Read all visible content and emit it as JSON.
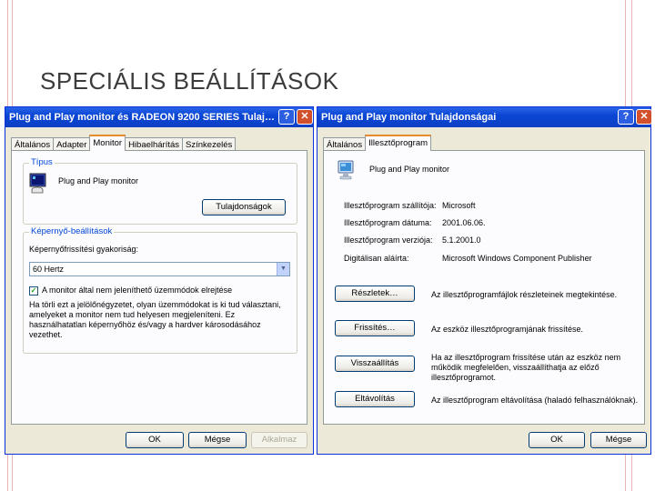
{
  "slide": {
    "title": "SPECIÁLIS BEÁLLÍTÁSOK"
  },
  "left_dialog": {
    "title": "Plug and Play monitor és RADEON 9200 SERIES  Tulaj…",
    "help_glyph": "?",
    "close_glyph": "✕",
    "tabs": [
      "Általános",
      "Adapter",
      "Monitor",
      "Hibaelhárítás",
      "Színkezelés"
    ],
    "active_tab": "Monitor",
    "type_group": {
      "title": "Típus",
      "monitor_name": "Plug and Play monitor",
      "properties_button": "Tulajdonságok"
    },
    "settings_group": {
      "title": "Képernyő-beállítások",
      "refresh_label": "Képernyőfrissítési gyakoriság:",
      "refresh_value": "60 Hertz",
      "hide_modes_label": "A monitor által nem jeleníthető üzemmódok elrejtése",
      "hide_modes_checked": true,
      "explanation": "Ha törli ezt a jelölőnégyzetet, olyan üzemmódokat is ki tud választani, amelyeket a monitor nem tud helyesen megjeleníteni. Ez használhatatlan képernyőhöz és/vagy a hardver károsodásához vezethet."
    },
    "buttons": {
      "ok": "OK",
      "cancel": "Mégse",
      "apply": "Alkalmaz"
    }
  },
  "right_dialog": {
    "title": "Plug and Play monitor Tulajdonságai",
    "help_glyph": "?",
    "close_glyph": "✕",
    "tabs": [
      "Általános",
      "Illesztőprogram"
    ],
    "active_tab": "Illesztőprogram",
    "device_name": "Plug and Play monitor",
    "info": [
      {
        "label": "Illesztőprogram szállítója:",
        "value": "Microsoft"
      },
      {
        "label": "Illesztőprogram dátuma:",
        "value": "2001.06.06."
      },
      {
        "label": "Illesztőprogram verziója:",
        "value": "5.1.2001.0"
      },
      {
        "label": "Digitálisan aláírta:",
        "value": "Microsoft Windows Component Publisher"
      }
    ],
    "actions": [
      {
        "button": "Részletek…",
        "description": "Az illesztőprogramfájlok részleteinek megtekintése."
      },
      {
        "button": "Frissítés…",
        "description": "Az eszköz illesztőprogramjának frissítése."
      },
      {
        "button": "Visszaállítás",
        "description": "Ha az illesztőprogram frissítése után az eszköz nem működik megfelelően, visszaállíthatja az előző illesztőprogramot."
      },
      {
        "button": "Eltávolítás",
        "description": "Az illesztőprogram eltávolítása (haladó felhasználóknak)."
      }
    ],
    "buttons": {
      "ok": "OK",
      "cancel": "Mégse"
    }
  }
}
